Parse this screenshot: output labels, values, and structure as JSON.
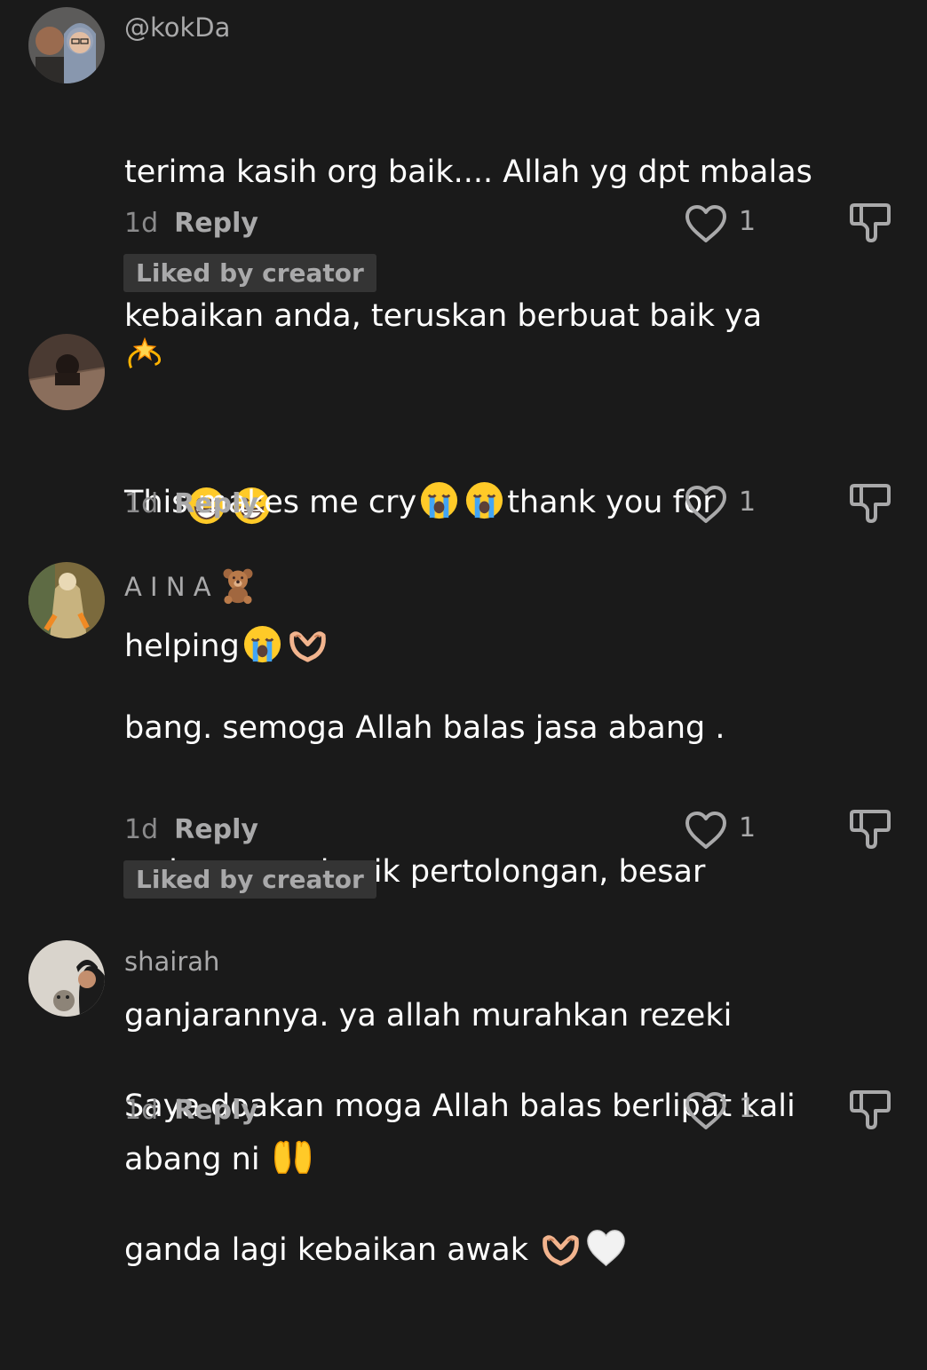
{
  "colors": {
    "background": "#1a1a1a",
    "username": "#a9a9aa",
    "meta": "#8b8b8c",
    "badge_bg": "#343434"
  },
  "comments": [
    {
      "username": "@kokDa",
      "text_lines": [
        "terima kasih org baik.... Allah yg dpt mbalas",
        "kebaikan anda, teruskan berbuat baik ya"
      ],
      "emojis": [
        "grinning-face-emoji",
        "grinning-face-emoji"
      ],
      "time": "1d",
      "reply_label": "Reply",
      "likes": "1",
      "liked_by_creator": "Liked by creator"
    },
    {
      "username_emoji": "dizzy-emoji",
      "text_line1": "This makes me cry",
      "text_line1_end": "thank you for",
      "text_line2": "helping",
      "time": "1d",
      "reply_label": "Reply",
      "likes": "1"
    },
    {
      "username": "A I N A",
      "username_emoji": "teddy-bear-emoji",
      "text_lines": [
        "bang. semoga Allah balas jasa abang .",
        "walaupun sekecik pertolongan, besar",
        "ganjarannya. ya allah murahkan rezeki",
        "abang ni "
      ],
      "time": "1d",
      "reply_label": "Reply",
      "likes": "1",
      "liked_by_creator": "Liked by creator"
    },
    {
      "username": "shairah",
      "text_lines": [
        "Saya doakan moga Allah balas berlipat kali",
        "ganda lagi kebaikan awak "
      ],
      "time": "1d",
      "reply_label": "Reply",
      "likes": "1"
    }
  ]
}
